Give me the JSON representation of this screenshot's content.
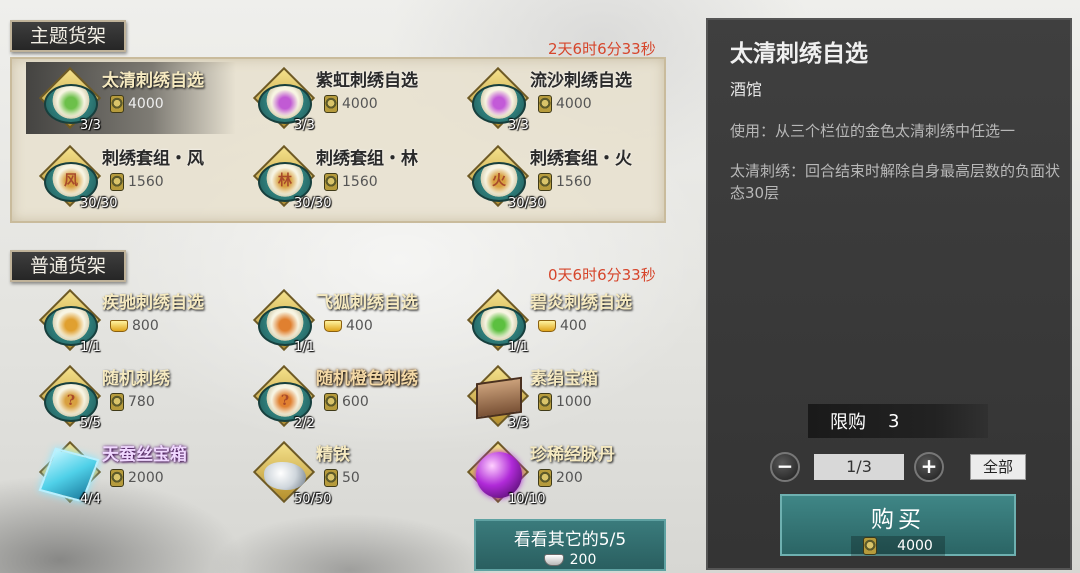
{
  "theme_shelf": {
    "title": "主题货架",
    "timer": "2天6时6分33秒",
    "items": [
      {
        "name": "太清刺绣自选",
        "price": "4000",
        "count": "3/3",
        "glyph": "",
        "color": "#6cc04a",
        "currency": "coin-icon",
        "selected": true
      },
      {
        "name": "紫虹刺绣自选",
        "price": "4000",
        "count": "3/3",
        "glyph": "",
        "color": "#c15ad4",
        "currency": "coin-icon"
      },
      {
        "name": "流沙刺绣自选",
        "price": "4000",
        "count": "3/3",
        "glyph": "",
        "color": "#c35ad8",
        "currency": "coin-icon"
      },
      {
        "name": "刺绣套组・风",
        "price": "1560",
        "count": "30/30",
        "glyph": "风",
        "color": "#d8a040",
        "currency": "coin-icon"
      },
      {
        "name": "刺绣套组・林",
        "price": "1560",
        "count": "30/30",
        "glyph": "林",
        "color": "#d8a040",
        "currency": "coin-icon"
      },
      {
        "name": "刺绣套组・火",
        "price": "1560",
        "count": "30/30",
        "glyph": "火",
        "color": "#d8a040",
        "currency": "coin-icon"
      }
    ]
  },
  "normal_shelf": {
    "title": "普通货架",
    "timer": "0天6时6分33秒",
    "items": [
      {
        "name": "疾驰刺绣自选",
        "price": "800",
        "count": "1/1",
        "glyph": "",
        "color": "#e0a030",
        "currency": "gold-ingot-icon",
        "style": "gold"
      },
      {
        "name": "飞狐刺绣自选",
        "price": "400",
        "count": "1/1",
        "glyph": "",
        "color": "#e08030",
        "currency": "gold-ingot-icon",
        "style": "gold"
      },
      {
        "name": "碧炎刺绣自选",
        "price": "400",
        "count": "1/1",
        "glyph": "",
        "color": "#5cc040",
        "currency": "gold-ingot-icon",
        "style": "gold"
      },
      {
        "name": "随机刺绣",
        "price": "780",
        "count": "5/5",
        "glyph": "?",
        "color": "#d8a040",
        "currency": "coin-icon",
        "style": "gold"
      },
      {
        "name": "随机橙色刺绣",
        "price": "600",
        "count": "2/2",
        "glyph": "?",
        "color": "#e08030",
        "currency": "coin-icon",
        "style": "orange"
      },
      {
        "name": "素绢宝箱",
        "price": "1000",
        "count": "3/3",
        "glyph": "",
        "color": "#c08a5a",
        "currency": "coin-icon",
        "style": "gold",
        "kind": "box"
      },
      {
        "name": "天蚕丝宝箱",
        "price": "2000",
        "count": "4/4",
        "glyph": "",
        "color": "#4fd0e8",
        "currency": "coin-icon",
        "style": "purple",
        "kind": "cube"
      },
      {
        "name": "精铁",
        "price": "50",
        "count": "50/50",
        "glyph": "",
        "color": "#cfd6dc",
        "currency": "coin-icon",
        "style": "gold",
        "kind": "ore"
      },
      {
        "name": "珍稀经脉丹",
        "price": "200",
        "count": "10/10",
        "glyph": "",
        "color": "#b02ad8",
        "currency": "coin-icon",
        "style": "gold",
        "kind": "orb"
      }
    ]
  },
  "other_button": {
    "label": "看看其它的5/5",
    "price": "200"
  },
  "detail": {
    "title": "太清刺绣自选",
    "category": "酒馆",
    "usage": "使用：从三个栏位的金色太清刺绣中任选一",
    "description": "太清刺绣：回合结束时解除自身最高层数的负面状态30层",
    "limit_label": "限购",
    "limit_value": "3",
    "quantity": "1/3",
    "all_label": "全部",
    "buy_label": "购买",
    "buy_price": "4000"
  }
}
